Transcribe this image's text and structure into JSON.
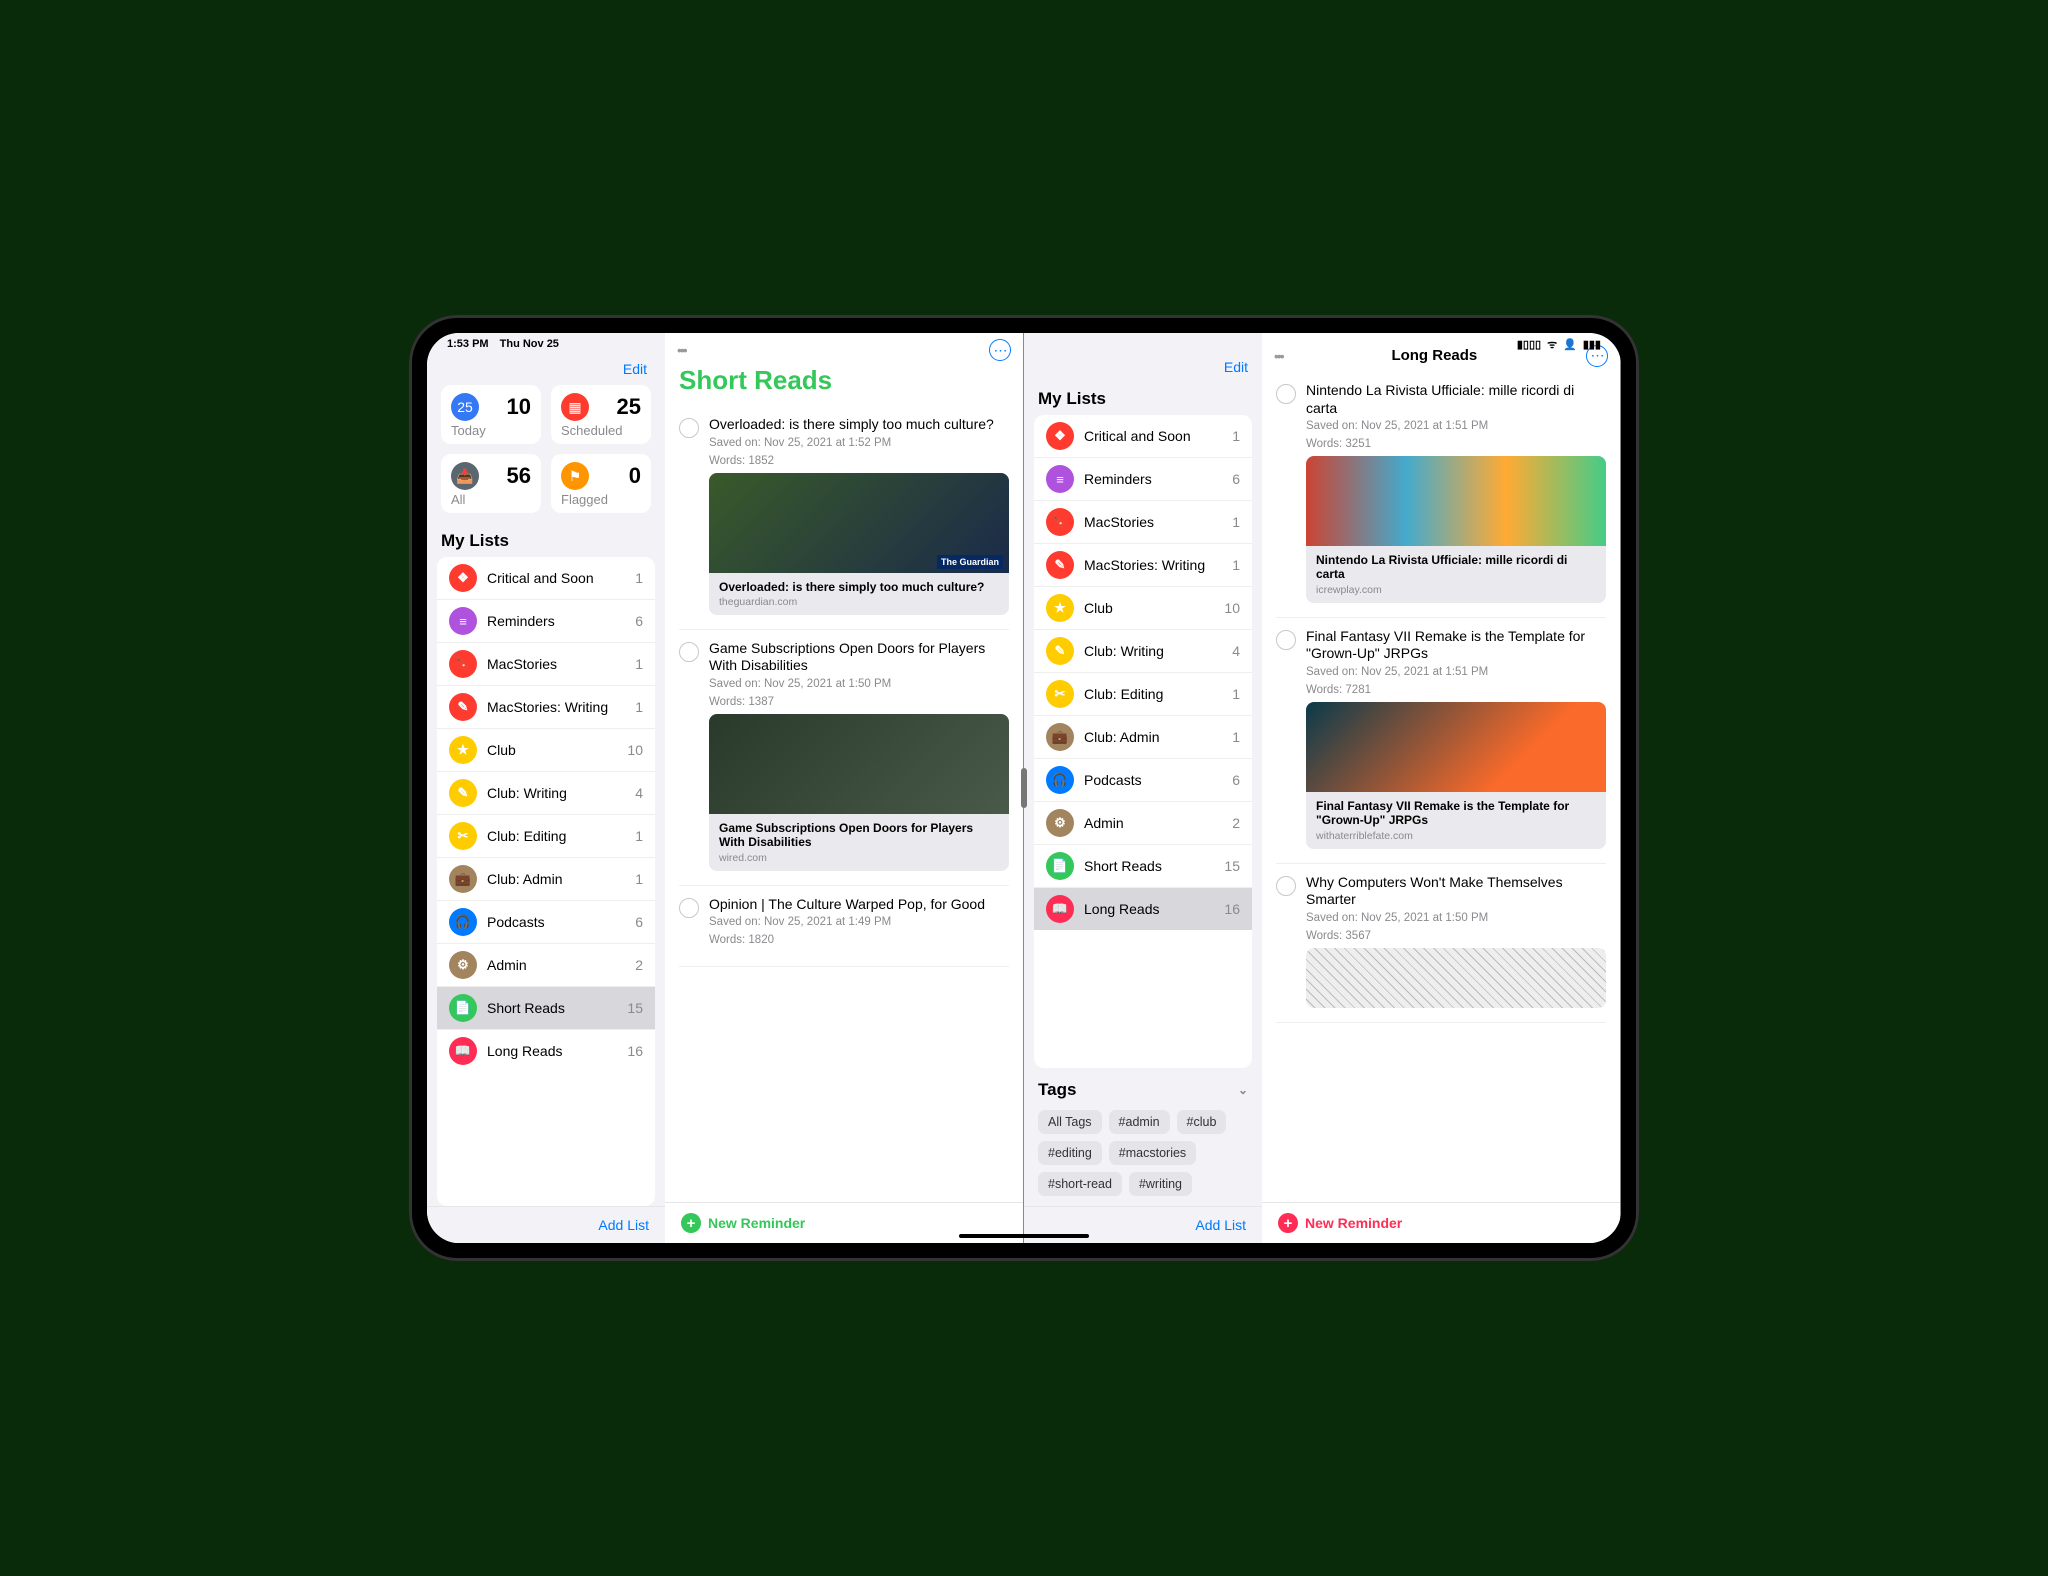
{
  "status": {
    "time": "1:53 PM",
    "date": "Thu Nov 25"
  },
  "left": {
    "edit": "Edit",
    "summary": [
      {
        "label": "Today",
        "count": 10,
        "color": "#3478f6",
        "icon": "25"
      },
      {
        "label": "Scheduled",
        "count": 25,
        "color": "#ff3b30",
        "icon": "▦"
      },
      {
        "label": "All",
        "count": 56,
        "color": "#5b6770",
        "icon": "📥"
      },
      {
        "label": "Flagged",
        "count": 0,
        "color": "#ff9500",
        "icon": "⚑"
      }
    ],
    "mylists_header": "My Lists",
    "lists": [
      {
        "label": "Critical and Soon",
        "count": 1,
        "color": "#ff3b30",
        "icon": "❖"
      },
      {
        "label": "Reminders",
        "count": 6,
        "color": "#af52de",
        "icon": "≡"
      },
      {
        "label": "MacStories",
        "count": 1,
        "color": "#ff3b30",
        "icon": "🔖"
      },
      {
        "label": "MacStories: Writing",
        "count": 1,
        "color": "#ff3b30",
        "icon": "✎"
      },
      {
        "label": "Club",
        "count": 10,
        "color": "#ffcc00",
        "icon": "★"
      },
      {
        "label": "Club: Writing",
        "count": 4,
        "color": "#ffcc00",
        "icon": "✎"
      },
      {
        "label": "Club: Editing",
        "count": 1,
        "color": "#ffcc00",
        "icon": "✂"
      },
      {
        "label": "Club: Admin",
        "count": 1,
        "color": "#a2845e",
        "icon": "💼"
      },
      {
        "label": "Podcasts",
        "count": 6,
        "color": "#007aff",
        "icon": "🎧"
      },
      {
        "label": "Admin",
        "count": 2,
        "color": "#a2845e",
        "icon": "⚙"
      },
      {
        "label": "Short Reads",
        "count": 15,
        "color": "#34c759",
        "icon": "📄",
        "selected": true
      },
      {
        "label": "Long Reads",
        "count": 16,
        "color": "#ff2d55",
        "icon": "📖"
      }
    ],
    "add_list": "Add List",
    "detail_title": "Short Reads",
    "detail_color": "#34c759",
    "new_reminder": "New Reminder",
    "items": [
      {
        "title": "Overloaded: is there simply too much culture?",
        "saved": "Saved on: Nov 25, 2021 at 1:52 PM",
        "words": "Words: 1852",
        "preview_title": "Overloaded: is there simply too much culture?",
        "preview_src": "theguardian.com",
        "imgclass": "guardian"
      },
      {
        "title": "Game Subscriptions Open Doors for Players With Disabilities",
        "saved": "Saved on: Nov 25, 2021 at 1:50 PM",
        "words": "Words: 1387",
        "preview_title": "Game Subscriptions Open Doors for Players With Disabilities",
        "preview_src": "wired.com",
        "imgclass": "wired"
      },
      {
        "title": "Opinion | The Culture Warped Pop, for Good",
        "saved": "Saved on: Nov 25, 2021 at 1:49 PM",
        "words": "Words: 1820",
        "preview_title": "",
        "preview_src": "",
        "imgclass": ""
      }
    ]
  },
  "right": {
    "edit": "Edit",
    "mylists_header": "My Lists",
    "lists": [
      {
        "label": "Critical and Soon",
        "count": 1,
        "color": "#ff3b30",
        "icon": "❖"
      },
      {
        "label": "Reminders",
        "count": 6,
        "color": "#af52de",
        "icon": "≡"
      },
      {
        "label": "MacStories",
        "count": 1,
        "color": "#ff3b30",
        "icon": "🔖"
      },
      {
        "label": "MacStories: Writing",
        "count": 1,
        "color": "#ff3b30",
        "icon": "✎"
      },
      {
        "label": "Club",
        "count": 10,
        "color": "#ffcc00",
        "icon": "★"
      },
      {
        "label": "Club: Writing",
        "count": 4,
        "color": "#ffcc00",
        "icon": "✎"
      },
      {
        "label": "Club: Editing",
        "count": 1,
        "color": "#ffcc00",
        "icon": "✂"
      },
      {
        "label": "Club: Admin",
        "count": 1,
        "color": "#a2845e",
        "icon": "💼"
      },
      {
        "label": "Podcasts",
        "count": 6,
        "color": "#007aff",
        "icon": "🎧"
      },
      {
        "label": "Admin",
        "count": 2,
        "color": "#a2845e",
        "icon": "⚙"
      },
      {
        "label": "Short Reads",
        "count": 15,
        "color": "#34c759",
        "icon": "📄"
      },
      {
        "label": "Long Reads",
        "count": 16,
        "color": "#ff2d55",
        "icon": "📖",
        "selected": true
      }
    ],
    "tags_header": "Tags",
    "tags": [
      "All Tags",
      "#admin",
      "#club",
      "#editing",
      "#macstories",
      "#short-read",
      "#writing"
    ],
    "add_list": "Add List",
    "detail_title": "Long Reads",
    "detail_color": "#ff2d55",
    "new_reminder": "New Reminder",
    "items": [
      {
        "title": "Nintendo La Rivista Ufficiale: mille ricordi di carta",
        "saved": "Saved on: Nov 25, 2021 at 1:51 PM",
        "words": "Words: 3251",
        "preview_title": "Nintendo La Rivista Ufficiale: mille ricordi di carta",
        "preview_src": "icrewplay.com",
        "imgclass": "nintendo"
      },
      {
        "title": "Final Fantasy VII Remake is the Template for \"Grown-Up\" JRPGs",
        "saved": "Saved on: Nov 25, 2021 at 1:51 PM",
        "words": "Words: 7281",
        "preview_title": "Final Fantasy VII Remake is the Template for \"Grown-Up\" JRPGs",
        "preview_src": "withaterriblefate.com",
        "imgclass": "ff7"
      },
      {
        "title": "Why Computers Won't Make Themselves Smarter",
        "saved": "Saved on: Nov 25, 2021 at 1:50 PM",
        "words": "Words: 3567",
        "preview_title": "",
        "preview_src": "",
        "imgclass": "wire3d"
      }
    ]
  }
}
